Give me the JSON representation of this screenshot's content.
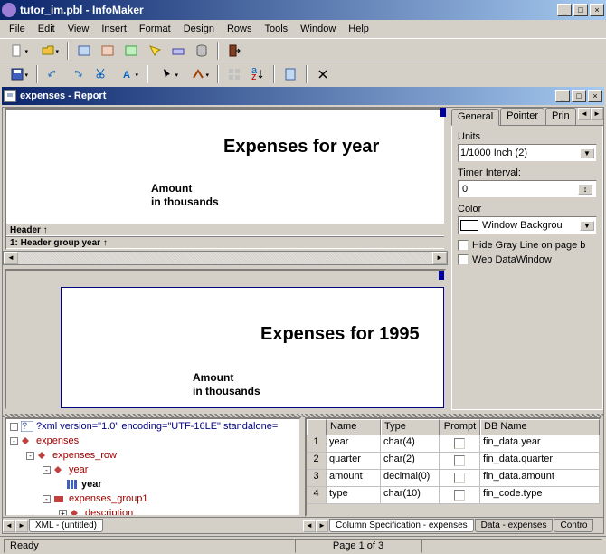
{
  "app": {
    "title": "tutor_im.pbl - InfoMaker"
  },
  "menu": [
    "File",
    "Edit",
    "View",
    "Insert",
    "Format",
    "Design",
    "Rows",
    "Tools",
    "Window",
    "Help"
  ],
  "doc": {
    "title": "expenses - Report"
  },
  "design": {
    "title": "Expenses for  year",
    "amount1": "Amount",
    "amount2": "in thousands",
    "band_header": "Header ↑",
    "band_group": "1: Header group year ↑"
  },
  "preview": {
    "title": "Expenses for  1995",
    "amount1": "Amount",
    "amount2": "in thousands"
  },
  "props": {
    "tabs": [
      "General",
      "Pointer",
      "Prin"
    ],
    "units_label": "Units",
    "units_value": "1/1000 Inch (2)",
    "timer_label": "Timer Interval:",
    "timer_value": "0",
    "color_label": "Color",
    "color_value": "Window Backgrou",
    "check1": "Hide Gray Line on page b",
    "check2": "Web DataWindow"
  },
  "tree": {
    "rows": [
      {
        "indent": 0,
        "box": "",
        "icon": "xml",
        "text": "?xml version=\"1.0\" encoding=\"UTF-16LE\" standalone=",
        "cls": "blue"
      },
      {
        "indent": 0,
        "box": "-",
        "icon": "tag",
        "text": "expenses",
        "cls": "red"
      },
      {
        "indent": 1,
        "box": "-",
        "icon": "tag",
        "text": "expenses_row",
        "cls": "red"
      },
      {
        "indent": 2,
        "box": "-",
        "icon": "tag",
        "text": "year",
        "cls": "red"
      },
      {
        "indent": 3,
        "box": "",
        "icon": "col",
        "text": "year",
        "cls": "black"
      },
      {
        "indent": 2,
        "box": "-",
        "icon": "grp",
        "text": "expenses_group1",
        "cls": "red"
      },
      {
        "indent": 3,
        "box": "+",
        "icon": "tag",
        "text": "description",
        "cls": "red"
      }
    ],
    "tab": "XML - (untitled)"
  },
  "colspec": {
    "headers": {
      "name": "Name",
      "type": "Type",
      "prompt": "Prompt",
      "db": "DB Name"
    },
    "rows": [
      {
        "n": "1",
        "name": "year",
        "type": "char(4)",
        "db": "fin_data.year"
      },
      {
        "n": "2",
        "name": "quarter",
        "type": "char(2)",
        "db": "fin_data.quarter"
      },
      {
        "n": "3",
        "name": "amount",
        "type": "decimal(0)",
        "db": "fin_data.amount"
      },
      {
        "n": "4",
        "name": "type",
        "type": "char(10)",
        "db": "fin_code.type"
      }
    ],
    "tabs": [
      "Column Specification - expenses",
      "Data - expenses",
      "Contro"
    ]
  },
  "status": {
    "ready": "Ready",
    "page": "Page 1 of 3"
  }
}
